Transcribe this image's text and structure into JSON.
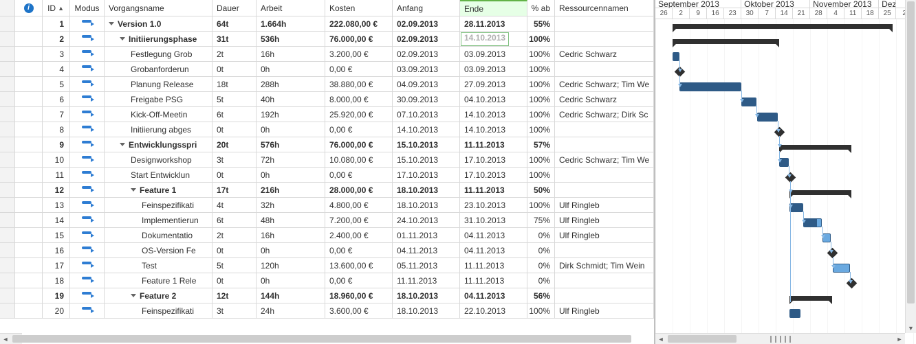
{
  "columns": {
    "info": "",
    "id": "ID",
    "mode": "Modus",
    "name": "Vorgangsname",
    "duration": "Dauer",
    "work": "Arbeit",
    "cost": "Kosten",
    "start": "Anfang",
    "end": "Ende",
    "percent": "% ab",
    "resources": "Ressourcennamen"
  },
  "timeline": {
    "months": [
      {
        "label": "September 2013",
        "weeks": 5
      },
      {
        "label": "Oktober 2013",
        "weeks": 4
      },
      {
        "label": "November 2013",
        "weeks": 4
      },
      {
        "label": "Dez",
        "weeks": 1
      }
    ],
    "days": [
      "26",
      "2",
      "9",
      "16",
      "23",
      "30",
      "7",
      "14",
      "21",
      "28",
      "4",
      "11",
      "18",
      "25",
      "2"
    ]
  },
  "rows": [
    {
      "id": "1",
      "bold": true,
      "indent": 0,
      "kind": "summary",
      "collapsible": true,
      "name": "Version 1.0",
      "dur": "64t",
      "work": "1.664h",
      "cost": "222.080,00 €",
      "start": "02.09.2013",
      "end": "28.11.2013",
      "pct": "55%",
      "res": "",
      "gLeft": 25,
      "gWidth": 320
    },
    {
      "id": "2",
      "bold": true,
      "indent": 1,
      "kind": "summary",
      "collapsible": true,
      "name": "Initiierungsphase",
      "dur": "31t",
      "work": "536h",
      "cost": "76.000,00 €",
      "start": "02.09.2013",
      "end": "14.10.2013",
      "end_editing": true,
      "pct": "100%",
      "res": "",
      "gLeft": 25,
      "gWidth": 155
    },
    {
      "id": "3",
      "bold": false,
      "indent": 2,
      "kind": "task",
      "name": "Festlegung Grob",
      "dur": "2t",
      "work": "16h",
      "cost": "3.200,00 €",
      "start": "02.09.2013",
      "end": "03.09.2013",
      "pct": "100%",
      "res": "Cedric Schwarz",
      "gLeft": 25,
      "gWidth": 10,
      "prog": 100
    },
    {
      "id": "4",
      "bold": false,
      "indent": 2,
      "kind": "milestone",
      "name": "Grobanforderun",
      "dur": "0t",
      "work": "0h",
      "cost": "0,00 €",
      "start": "03.09.2013",
      "end": "03.09.2013",
      "pct": "100%",
      "res": "",
      "gLeft": 30
    },
    {
      "id": "5",
      "bold": false,
      "indent": 2,
      "kind": "task",
      "name": "Planung Release",
      "dur": "18t",
      "work": "288h",
      "cost": "38.880,00 €",
      "start": "04.09.2013",
      "end": "27.09.2013",
      "pct": "100%",
      "res": "Cedric Schwarz; Tim We",
      "gLeft": 35,
      "gWidth": 90,
      "prog": 100
    },
    {
      "id": "6",
      "bold": false,
      "indent": 2,
      "kind": "task",
      "name": "Freigabe PSG",
      "dur": "5t",
      "work": "40h",
      "cost": "8.000,00 €",
      "start": "30.09.2013",
      "end": "04.10.2013",
      "pct": "100%",
      "res": "Cedric Schwarz",
      "gLeft": 125,
      "gWidth": 22,
      "prog": 100
    },
    {
      "id": "7",
      "bold": false,
      "indent": 2,
      "kind": "task",
      "name": "Kick-Off-Meetin",
      "dur": "6t",
      "work": "192h",
      "cost": "25.920,00 €",
      "start": "07.10.2013",
      "end": "14.10.2013",
      "pct": "100%",
      "res": "Cedric Schwarz; Dirk Sc",
      "gLeft": 148,
      "gWidth": 30,
      "prog": 100
    },
    {
      "id": "8",
      "bold": false,
      "indent": 2,
      "kind": "milestone",
      "name": "Initiierung abges",
      "dur": "0t",
      "work": "0h",
      "cost": "0,00 €",
      "start": "14.10.2013",
      "end": "14.10.2013",
      "pct": "100%",
      "res": "",
      "gLeft": 175
    },
    {
      "id": "9",
      "bold": true,
      "indent": 1,
      "kind": "summary",
      "collapsible": true,
      "name": "Entwicklungsspri",
      "dur": "20t",
      "work": "576h",
      "cost": "76.000,00 €",
      "start": "15.10.2013",
      "end": "11.11.2013",
      "pct": "57%",
      "res": "",
      "gLeft": 180,
      "gWidth": 105
    },
    {
      "id": "10",
      "bold": false,
      "indent": 2,
      "kind": "task",
      "name": "Designworkshop",
      "dur": "3t",
      "work": "72h",
      "cost": "10.080,00 €",
      "start": "15.10.2013",
      "end": "17.10.2013",
      "pct": "100%",
      "res": "Cedric Schwarz; Tim We",
      "gLeft": 180,
      "gWidth": 14,
      "prog": 100
    },
    {
      "id": "11",
      "bold": false,
      "indent": 2,
      "kind": "milestone",
      "name": "Start Entwicklun",
      "dur": "0t",
      "work": "0h",
      "cost": "0,00 €",
      "start": "17.10.2013",
      "end": "17.10.2013",
      "pct": "100%",
      "res": "",
      "gLeft": 191
    },
    {
      "id": "12",
      "bold": true,
      "indent": 2,
      "kind": "summary",
      "collapsible": true,
      "name": "Feature 1",
      "dur": "17t",
      "work": "216h",
      "cost": "28.000,00 €",
      "start": "18.10.2013",
      "end": "11.11.2013",
      "pct": "50%",
      "res": "",
      "gLeft": 195,
      "gWidth": 90
    },
    {
      "id": "13",
      "bold": false,
      "indent": 3,
      "kind": "task",
      "name": "Feinspezifikati",
      "dur": "4t",
      "work": "32h",
      "cost": "4.800,00 €",
      "start": "18.10.2013",
      "end": "23.10.2013",
      "pct": "100%",
      "res": "Ulf Ringleb",
      "gLeft": 195,
      "gWidth": 20,
      "prog": 100
    },
    {
      "id": "14",
      "bold": false,
      "indent": 3,
      "kind": "task",
      "name": "Implementierun",
      "dur": "6t",
      "work": "48h",
      "cost": "7.200,00 €",
      "start": "24.10.2013",
      "end": "31.10.2013",
      "pct": "75%",
      "res": "Ulf Ringleb",
      "gLeft": 215,
      "gWidth": 27,
      "prog": 75
    },
    {
      "id": "15",
      "bold": false,
      "indent": 3,
      "kind": "task",
      "name": "Dokumentatio",
      "dur": "2t",
      "work": "16h",
      "cost": "2.400,00 €",
      "start": "01.11.2013",
      "end": "04.11.2013",
      "pct": "0%",
      "res": "Ulf Ringleb",
      "gLeft": 243,
      "gWidth": 12,
      "prog": 0
    },
    {
      "id": "16",
      "bold": false,
      "indent": 3,
      "kind": "milestone",
      "name": "OS-Version Fe",
      "dur": "0t",
      "work": "0h",
      "cost": "0,00 €",
      "start": "04.11.2013",
      "end": "04.11.2013",
      "pct": "0%",
      "res": "",
      "gLeft": 252
    },
    {
      "id": "17",
      "bold": false,
      "indent": 3,
      "kind": "task",
      "name": "Test",
      "dur": "5t",
      "work": "120h",
      "cost": "13.600,00 €",
      "start": "05.11.2013",
      "end": "11.11.2013",
      "pct": "0%",
      "res": "Dirk Schmidt; Tim Wein",
      "gLeft": 258,
      "gWidth": 25,
      "prog": 0
    },
    {
      "id": "18",
      "bold": false,
      "indent": 3,
      "kind": "milestone",
      "name": "Feature 1 Rele",
      "dur": "0t",
      "work": "0h",
      "cost": "0,00 €",
      "start": "11.11.2013",
      "end": "11.11.2013",
      "pct": "0%",
      "res": "",
      "gLeft": 280
    },
    {
      "id": "19",
      "bold": true,
      "indent": 2,
      "kind": "summary",
      "collapsible": true,
      "name": "Feature 2",
      "dur": "12t",
      "work": "144h",
      "cost": "18.960,00 €",
      "start": "18.10.2013",
      "end": "04.11.2013",
      "pct": "56%",
      "res": "",
      "gLeft": 195,
      "gWidth": 62
    },
    {
      "id": "20",
      "bold": false,
      "indent": 3,
      "kind": "task",
      "name": "Feinspezifikati",
      "dur": "3t",
      "work": "24h",
      "cost": "3.600,00 €",
      "start": "18.10.2013",
      "end": "22.10.2013",
      "pct": "100%",
      "res": "Ulf Ringleb",
      "gLeft": 195,
      "gWidth": 16,
      "prog": 100
    }
  ]
}
